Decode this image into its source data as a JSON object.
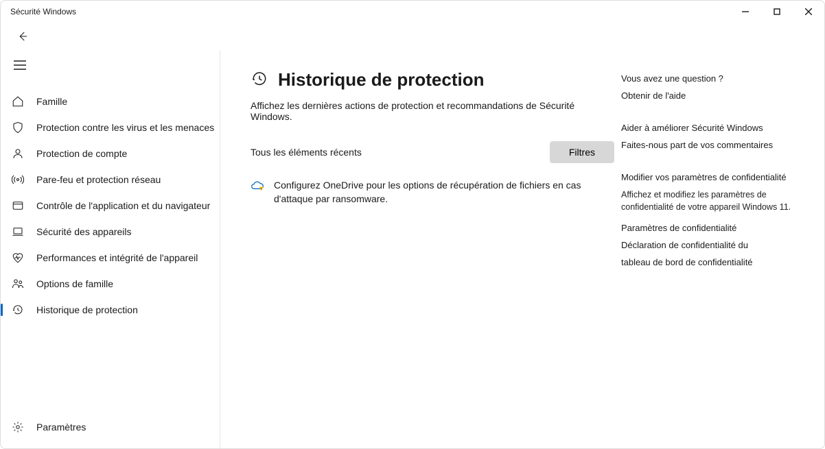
{
  "window": {
    "title": "Sécurité Windows"
  },
  "sidebar": {
    "items": [
      {
        "label": "Famille"
      },
      {
        "label": "Protection contre les virus et les menaces"
      },
      {
        "label": "Protection de compte"
      },
      {
        "label": "Pare-feu et protection réseau"
      },
      {
        "label": "Contrôle de l'application et du navigateur"
      },
      {
        "label": "Sécurité des appareils"
      },
      {
        "label": "Performances et intégrité de l'appareil"
      },
      {
        "label": "Options de famille"
      },
      {
        "label": "Historique de protection"
      }
    ],
    "footer": {
      "label": "Paramètres"
    }
  },
  "page": {
    "title": "Historique de protection",
    "subtitle": "Affichez les dernières actions de protection et recommandations de Sécurité Windows.",
    "section_label": "Tous les éléments récents",
    "filter_label": "Filtres",
    "notice": "Configurez OneDrive pour les options de récupération de fichiers en cas d'attaque par ransomware."
  },
  "aside": {
    "question_heading": "Vous avez une question ?",
    "help_link": "Obtenir de l'aide",
    "improve_heading": "Aider à améliorer Sécurité Windows",
    "feedback_link": "Faites-nous part de vos commentaires",
    "privacy_heading": "Modifier vos paramètres de confidentialité",
    "privacy_sub": "Affichez et modifiez les paramètres de confidentialité de votre appareil Windows 11.",
    "privacy_link1": "Paramètres de confidentialité",
    "privacy_link2": "Déclaration de confidentialité du",
    "privacy_link3": "tableau de bord de confidentialité"
  }
}
